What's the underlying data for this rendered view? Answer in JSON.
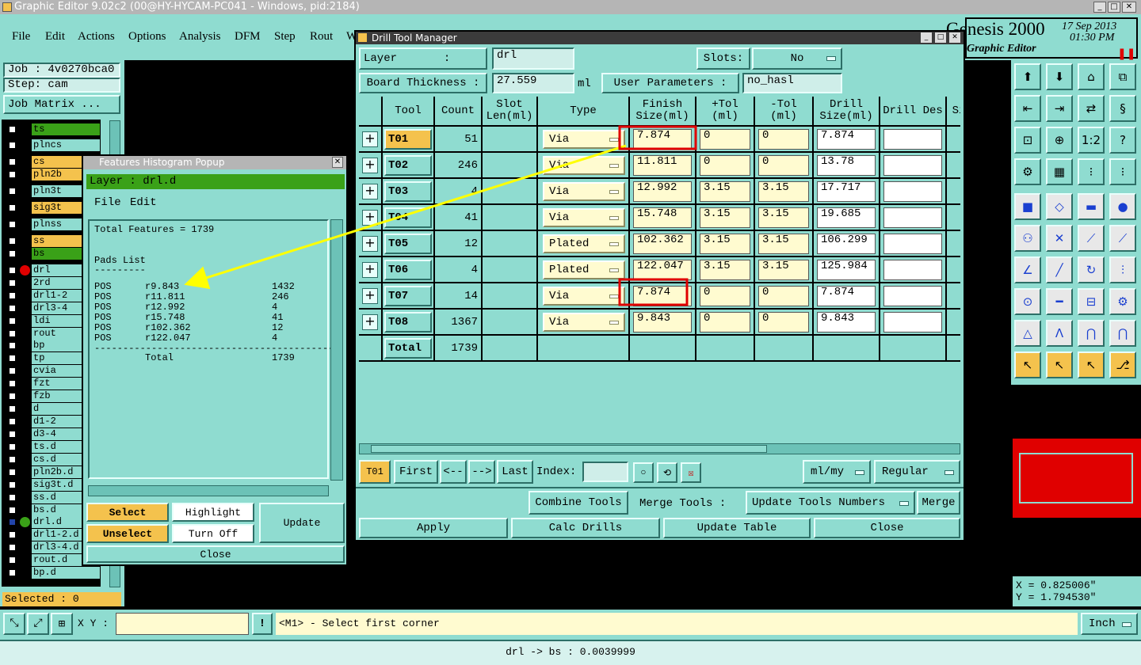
{
  "window": {
    "title": "Graphic Editor 9.02c2 (00@HY-HYCAM-PC041 - Windows, pid:2184)",
    "brand": "Genesis 2000",
    "brand_sub": "Graphic Editor",
    "date": "17 Sep 2013",
    "time": "01:30 PM"
  },
  "menu": [
    "File",
    "Edit",
    "Actions",
    "Options",
    "Analysis",
    "DFM",
    "Step",
    "Rout",
    "W"
  ],
  "left": {
    "job": "Job : 4v0270bca0",
    "step": "Step: cam",
    "job_matrix": "Job Matrix ...",
    "layers": [
      "ts",
      "plncs",
      "cs",
      "pln2b",
      "pln3t",
      "sig3t",
      "plnss",
      "ss",
      "bs",
      "drl",
      "2rd",
      "drl1-2",
      "drl3-4",
      "ldi",
      "rout",
      "bp",
      "tp",
      "cvia",
      "fzt",
      "fzb",
      "d",
      "d1-2",
      "d3-4",
      "ts.d",
      "cs.d",
      "pln2b.d",
      "sig3t.d",
      "ss.d",
      "bs.d",
      "drl.d",
      "drl1-2.d",
      "drl3-4.d",
      "rout.d",
      "bp.d"
    ],
    "selected": "Selected : 0"
  },
  "hist": {
    "title": "Features Histogram Popup",
    "layer": "Layer :  drl.d",
    "menu_file": "File",
    "menu_edit": "Edit",
    "total_features": "Total Features = 1739",
    "pads_list": "Pads List",
    "pads_underline": "---------",
    "rows": [
      {
        "type": "POS",
        "sym": "r9.843",
        "count": "1432"
      },
      {
        "type": "POS",
        "sym": "r11.811",
        "count": "246"
      },
      {
        "type": "POS",
        "sym": "r12.992",
        "count": "4"
      },
      {
        "type": "POS",
        "sym": "r15.748",
        "count": "41"
      },
      {
        "type": "POS",
        "sym": "r102.362",
        "count": "12"
      },
      {
        "type": "POS",
        "sym": "r122.047",
        "count": "4"
      }
    ],
    "dashes": "-------------------------------------------",
    "total_label": "Total",
    "total_value": "1739",
    "btn_select": "Select",
    "btn_unselect": "Unselect",
    "btn_highlight": "Highlight",
    "btn_turnoff": "Turn Off",
    "btn_update": "Update",
    "btn_close": "Close"
  },
  "dtm": {
    "title": "Drill Tool Manager",
    "layer_label": "Layer       :",
    "layer_value": "drl",
    "slots_label": "Slots:",
    "slots_value": "No",
    "board_thickness_label": "Board Thickness :",
    "board_thickness_value": "27.559",
    "board_thickness_unit": "ml",
    "user_params_label": "User Parameters :",
    "user_params_value": "no_hasl",
    "headers": {
      "tool": "Tool",
      "count": "Count",
      "slot": "Slot Len(ml)",
      "type": "Type",
      "finish": "Finish Size(ml)",
      "ptol": "+Tol (ml)",
      "mtol": "-Tol (ml)",
      "drill": "Drill Size(ml)",
      "des": "Drill Des",
      "si": "Si"
    },
    "rows": [
      {
        "tool": "T01",
        "count": "51",
        "type": "Via",
        "finish": "7.874",
        "ptol": "0",
        "mtol": "0",
        "drill": "7.874"
      },
      {
        "tool": "T02",
        "count": "246",
        "type": "Via",
        "finish": "11.811",
        "ptol": "0",
        "mtol": "0",
        "drill": "13.78"
      },
      {
        "tool": "T03",
        "count": "4",
        "type": "Via",
        "finish": "12.992",
        "ptol": "3.15",
        "mtol": "3.15",
        "drill": "17.717"
      },
      {
        "tool": "T04",
        "count": "41",
        "type": "Via",
        "finish": "15.748",
        "ptol": "3.15",
        "mtol": "3.15",
        "drill": "19.685"
      },
      {
        "tool": "T05",
        "count": "12",
        "type": "Plated",
        "finish": "102.362",
        "ptol": "3.15",
        "mtol": "3.15",
        "drill": "106.299"
      },
      {
        "tool": "T06",
        "count": "4",
        "type": "Plated",
        "finish": "122.047",
        "ptol": "3.15",
        "mtol": "3.15",
        "drill": "125.984"
      },
      {
        "tool": "T07",
        "count": "14",
        "type": "Via",
        "finish": "7.874",
        "ptol": "0",
        "mtol": "0",
        "drill": "7.874"
      },
      {
        "tool": "T08",
        "count": "1367",
        "type": "Via",
        "finish": "9.843",
        "ptol": "0",
        "mtol": "0",
        "drill": "9.843"
      }
    ],
    "total_label": "Total",
    "total_value": "1739",
    "nav_current": "T01",
    "nav_first": "First",
    "nav_prev": "<--",
    "nav_next": "-->",
    "nav_last": "Last",
    "index_label": "Index:",
    "units": "ml/my",
    "mode": "Regular",
    "combine_tools": "Combine Tools",
    "merge_tools_label": "Merge Tools :",
    "update_tools_numbers": "Update Tools Numbers",
    "merge": "Merge",
    "apply": "Apply",
    "calc_drills": "Calc Drills",
    "update_table": "Update Table",
    "close": "Close"
  },
  "coords": {
    "x": "X = 0.825006\"",
    "y": "Y = 1.794530\""
  },
  "status": {
    "xy_label": "X Y :",
    "prompt": "<M1> - Select first corner",
    "units": "Inch",
    "bottom_msg": "drl -> bs : 0.0039999"
  },
  "colors": {
    "panel": "#8fdcd0",
    "highlight_orange": "#f4c24d",
    "annotation_yellow": "#ffff00",
    "annotation_red": "#e00000"
  }
}
